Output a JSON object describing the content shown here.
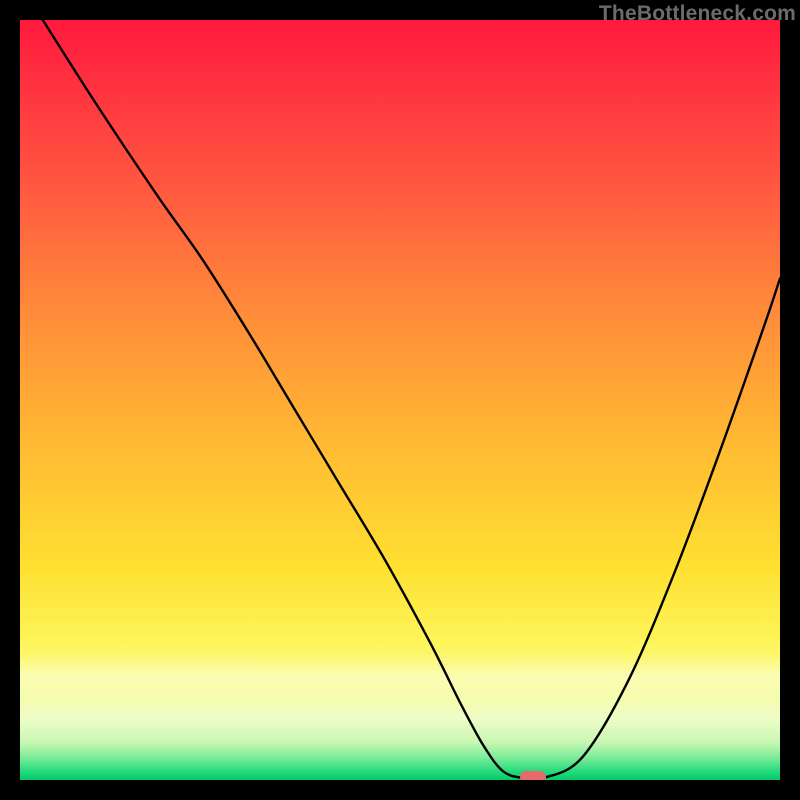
{
  "watermark": "TheBottleneck.com",
  "chart_data": {
    "type": "line",
    "title": "",
    "xlabel": "",
    "ylabel": "",
    "xlim": [
      0,
      100
    ],
    "ylim": [
      0,
      100
    ],
    "grid": false,
    "legend": false,
    "series": [
      {
        "name": "bottleneck-curve",
        "x": [
          3,
          10,
          18,
          24,
          30,
          36,
          42,
          48,
          54,
          58,
          61,
          63.5,
          66,
          69,
          74,
          80,
          86,
          92,
          98,
          100
        ],
        "y": [
          100,
          89,
          77,
          68.5,
          59,
          49,
          39,
          29,
          18,
          10,
          4.5,
          1.2,
          0.3,
          0.3,
          3,
          13,
          27,
          43,
          60,
          66
        ]
      }
    ],
    "marker": {
      "x": 67.5,
      "y": 0.4,
      "color": "#e66a6a"
    },
    "background_gradient": {
      "stops": [
        {
          "pos": 0.0,
          "color": "#ff1a3d"
        },
        {
          "pos": 0.22,
          "color": "#ff5840"
        },
        {
          "pos": 0.55,
          "color": "#ffb833"
        },
        {
          "pos": 0.82,
          "color": "#fdf55a"
        },
        {
          "pos": 0.95,
          "color": "#c9f7b3"
        },
        {
          "pos": 1.0,
          "color": "#06c96a"
        }
      ]
    }
  }
}
